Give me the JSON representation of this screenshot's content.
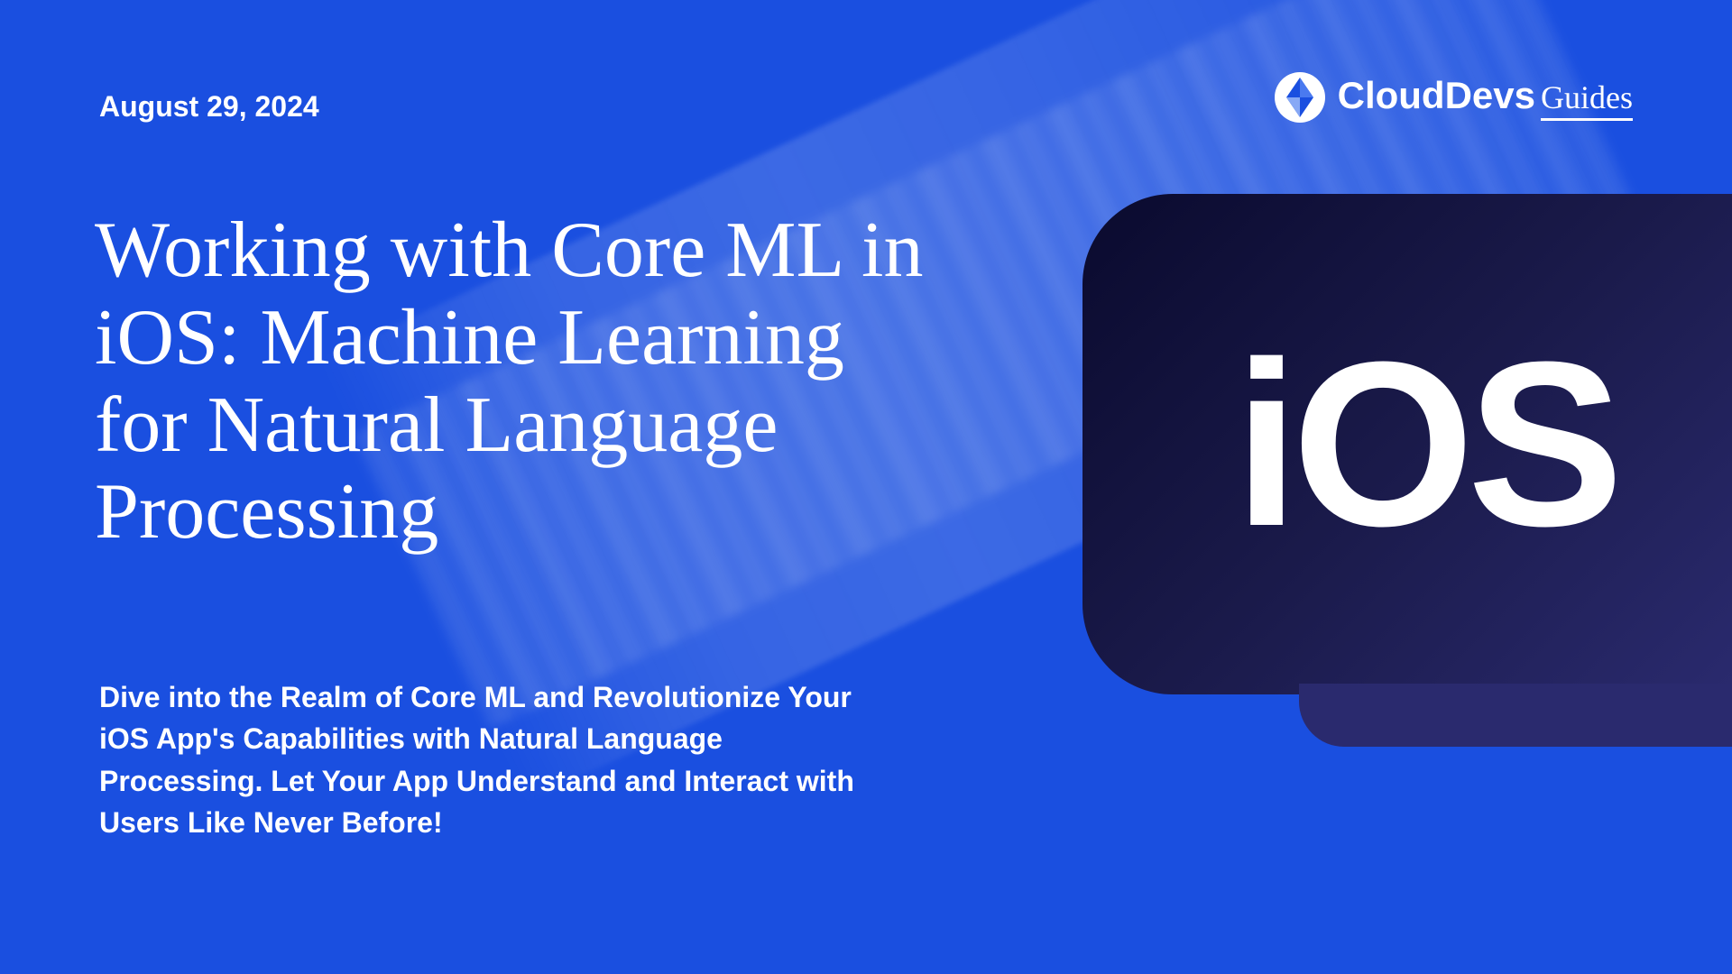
{
  "date": "August 29, 2024",
  "title": "Working with Core ML in iOS: Machine Learning for Natural Language Processing",
  "subtitle": "Dive into the Realm of Core ML and Revolutionize Your iOS App's Capabilities with Natural Language Processing. Let Your App Understand and Interact with Users Like Never Before!",
  "logo": {
    "brand": "CloudDevs",
    "suffix": "Guides"
  },
  "badge": {
    "text": "iOS"
  }
}
